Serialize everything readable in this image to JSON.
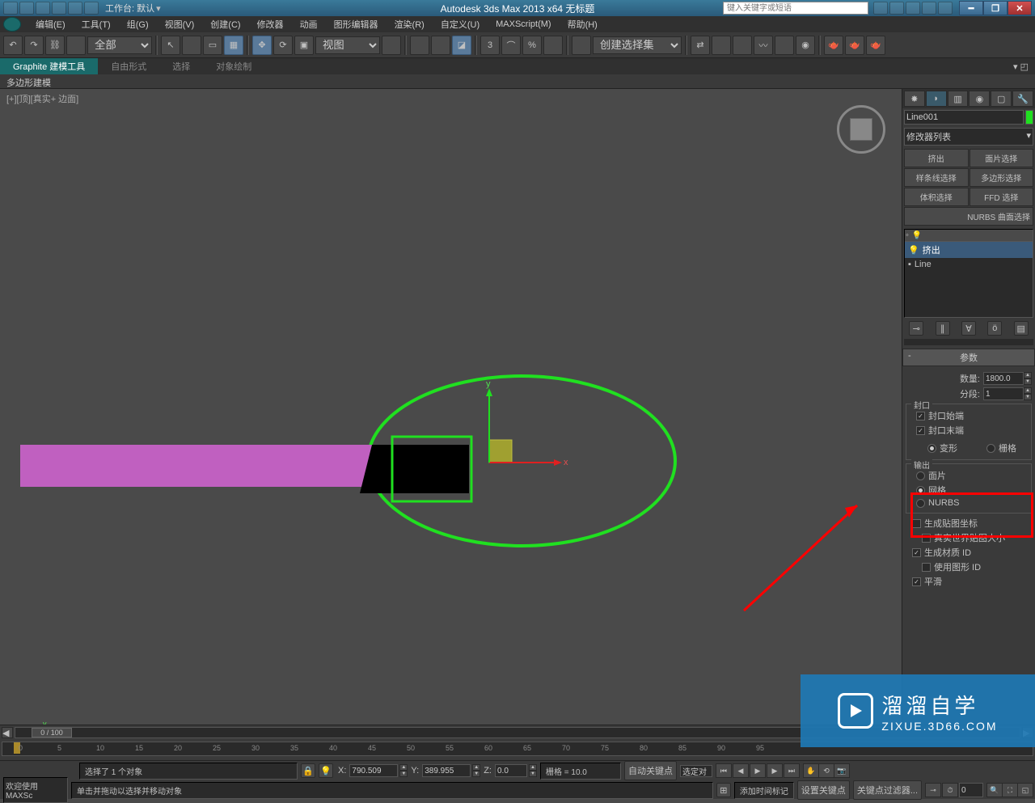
{
  "title_bar": {
    "workspace_label": "工作台: 默认",
    "app_title": "Autodesk 3ds Max  2013 x64   无标题",
    "search_placeholder": "键入关键字或短语"
  },
  "menu": {
    "items": [
      "编辑(E)",
      "工具(T)",
      "组(G)",
      "视图(V)",
      "创建(C)",
      "修改器",
      "动画",
      "图形编辑器",
      "渲染(R)",
      "自定义(U)",
      "MAXScript(M)",
      "帮助(H)"
    ]
  },
  "toolbar": {
    "filter_dropdown": "全部",
    "view_dropdown": "视图",
    "set_dropdown": "创建选择集"
  },
  "ribbon": {
    "tabs": [
      "Graphite 建模工具",
      "自由形式",
      "选择",
      "对象绘制"
    ],
    "sub": "多边形建模"
  },
  "viewport": {
    "label": "[+][顶][真实+ 边面]",
    "axis_x": "x",
    "axis_y": "y"
  },
  "command_panel": {
    "object_name": "Line001",
    "modifier_list_label": "修改器列表",
    "mod_buttons": [
      "挤出",
      "面片选择",
      "样条线选择",
      "多边形选择",
      "体积选择",
      "FFD 选择"
    ],
    "nurbs_row": "NURBS 曲面选择",
    "stack": {
      "item0": "挤出",
      "item1": "Line"
    },
    "rollout_params": "参数",
    "amount_label": "数量:",
    "amount_value": "1800.0",
    "segments_label": "分段:",
    "segments_value": "1",
    "cap_group": "封口",
    "cap_start": "封口始端",
    "cap_end": "封口末端",
    "morph": "变形",
    "grid": "栅格",
    "output_group": "输出",
    "patch": "面片",
    "mesh": "网格",
    "nurbs": "NURBS",
    "gen_map": "生成贴图坐标",
    "real_world": "真实世界贴图大小",
    "gen_mat": "生成材质 ID",
    "use_shape": "使用图形 ID",
    "smooth": "平滑"
  },
  "timeline": {
    "slider_label": "0 / 100",
    "ticks": [
      "0",
      "5",
      "10",
      "15",
      "20",
      "25",
      "30",
      "35",
      "40",
      "45",
      "50",
      "55",
      "60",
      "65",
      "70",
      "75",
      "80",
      "85",
      "90",
      "95"
    ]
  },
  "status": {
    "selection": "选择了 1 个对象",
    "prompt": "单击并拖动以选择并移动对象",
    "welcome": "欢迎使用  MAXSc",
    "x_val": "790.509",
    "y_val": "389.955",
    "z_val": "0.0",
    "grid": "栅格 = 10.0",
    "auto_key": "自动关键点",
    "selected_set": "选定对",
    "set_key": "设置关键点",
    "key_filter": "关键点过滤器...",
    "add_time_tag": "添加时间标记"
  },
  "watermark": {
    "big": "溜溜自学",
    "small": "ZIXUE.3D66.COM"
  }
}
